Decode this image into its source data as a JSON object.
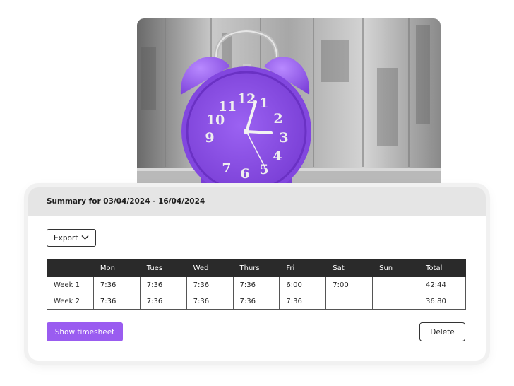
{
  "photo": {
    "subject": "purple-alarm-clock",
    "accent": "#8a4fe0"
  },
  "summary": {
    "title": "Summary for 03/04/2024 - 16/04/2024",
    "export_label": "Export",
    "columns": [
      "",
      "Mon",
      "Tues",
      "Wed",
      "Thurs",
      "Fri",
      "Sat",
      "Sun",
      "Total"
    ],
    "rows": [
      [
        "Week 1",
        "7:36",
        "7:36",
        "7:36",
        "7:36",
        "6:00",
        "7:00",
        "",
        "42:44"
      ],
      [
        "Week 2",
        "7:36",
        "7:36",
        "7:36",
        "7:36",
        "7:36",
        "",
        "",
        "36:80"
      ]
    ],
    "show_timesheet_label": "Show timesheet",
    "delete_label": "Delete"
  },
  "colors": {
    "accent": "#9a5cf0",
    "header_bg": "#e5e5e5",
    "table_head": "#2a2a2a"
  }
}
